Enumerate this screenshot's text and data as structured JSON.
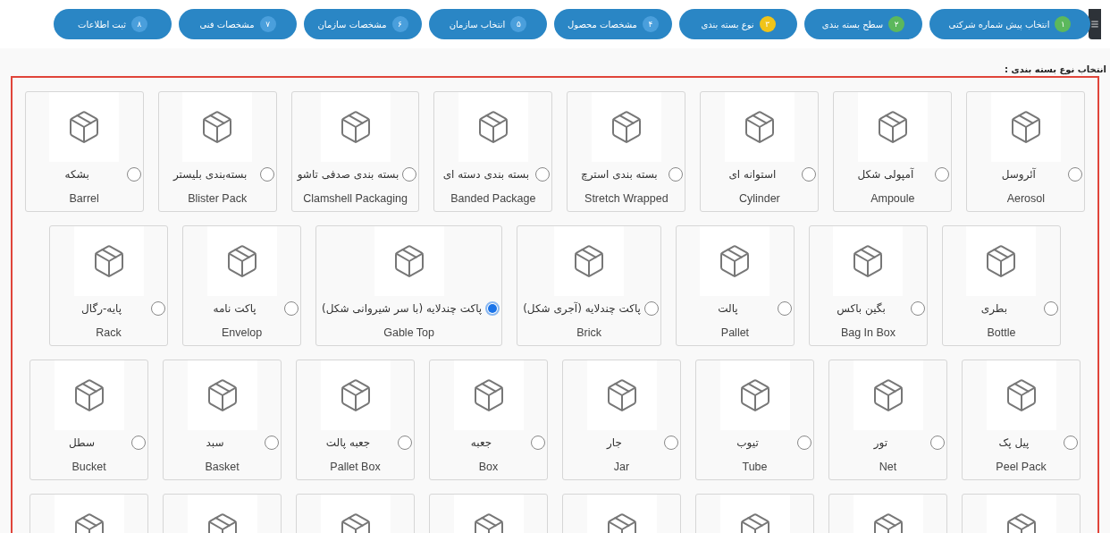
{
  "steps": [
    {
      "number": "۱",
      "label": "انتخاب پیش شماره شرکتی",
      "color": "#5cb85c"
    },
    {
      "number": "۲",
      "label": "سطح بسته بندی",
      "color": "#5cb85c"
    },
    {
      "number": "۳",
      "label": "نوع بسته بندی",
      "color": "#f0c419"
    },
    {
      "number": "۴",
      "label": "مشخصات محصول",
      "color": "#4a9fdc"
    },
    {
      "number": "۵",
      "label": "انتخاب سازمان",
      "color": "#4a9fdc"
    },
    {
      "number": "۶",
      "label": "مشخصات سازمان",
      "color": "#4a9fdc"
    },
    {
      "number": "۷",
      "label": "مشخصات فنی",
      "color": "#4a9fdc"
    },
    {
      "number": "۸",
      "label": "ثبت اطلاعات",
      "color": "#4a9fdc"
    }
  ],
  "section_title": "انتخاب نوع بسته بندی :",
  "rows": [
    [
      {
        "fa": "آئروسل",
        "en": "Aerosol",
        "selected": false
      },
      {
        "fa": "آمپولی شکل",
        "en": "Ampoule",
        "selected": false
      },
      {
        "fa": "استوانه ای",
        "en": "Cylinder",
        "selected": false
      },
      {
        "fa": "بسته بندی استرچ",
        "en": "Stretch Wrapped",
        "selected": false
      },
      {
        "fa": "بسته بندی دسته ای",
        "en": "Banded Package",
        "selected": false
      },
      {
        "fa": "بسته بندی صدفی تاشو",
        "en": "Clamshell Packaging",
        "selected": false
      },
      {
        "fa": "بسته‌بندی بلیستر",
        "en": "Blister Pack",
        "selected": false
      },
      {
        "fa": "بشکه",
        "en": "Barrel",
        "selected": false
      }
    ],
    [
      {
        "fa": "بطری",
        "en": "Bottle",
        "selected": false
      },
      {
        "fa": "بگین باکس",
        "en": "Bag In Box",
        "selected": false
      },
      {
        "fa": "پالت",
        "en": "Pallet",
        "selected": false
      },
      {
        "fa": "پاکت چندلایه (آجری شکل)",
        "en": "Brick",
        "selected": false
      },
      {
        "fa": "پاکت چندلایه (با سر شیروانی شکل)",
        "en": "Gable Top",
        "selected": true
      },
      {
        "fa": "پاکت نامه",
        "en": "Envelop",
        "selected": false
      },
      {
        "fa": "پایه-رگال",
        "en": "Rack",
        "selected": false
      }
    ],
    [
      {
        "fa": "پیل پک",
        "en": "Peel Pack",
        "selected": false
      },
      {
        "fa": "تور",
        "en": "Net",
        "selected": false
      },
      {
        "fa": "تیوب",
        "en": "Tube",
        "selected": false
      },
      {
        "fa": "جار",
        "en": "Jar",
        "selected": false
      },
      {
        "fa": "جعبه",
        "en": "Box",
        "selected": false
      },
      {
        "fa": "جعبه پالت",
        "en": "Pallet Box",
        "selected": false
      },
      {
        "fa": "سبد",
        "en": "Basket",
        "selected": false
      },
      {
        "fa": "سطل",
        "en": "Bucket",
        "selected": false
      }
    ]
  ],
  "partial_row": [
    {
      "kind": "picture"
    },
    {
      "kind": "picture"
    },
    {
      "kind": "picture"
    },
    {
      "kind": "picture"
    },
    {
      "kind": "picture"
    },
    {
      "kind": "picture"
    },
    {
      "kind": "picture"
    },
    {
      "kind": "picture"
    }
  ]
}
